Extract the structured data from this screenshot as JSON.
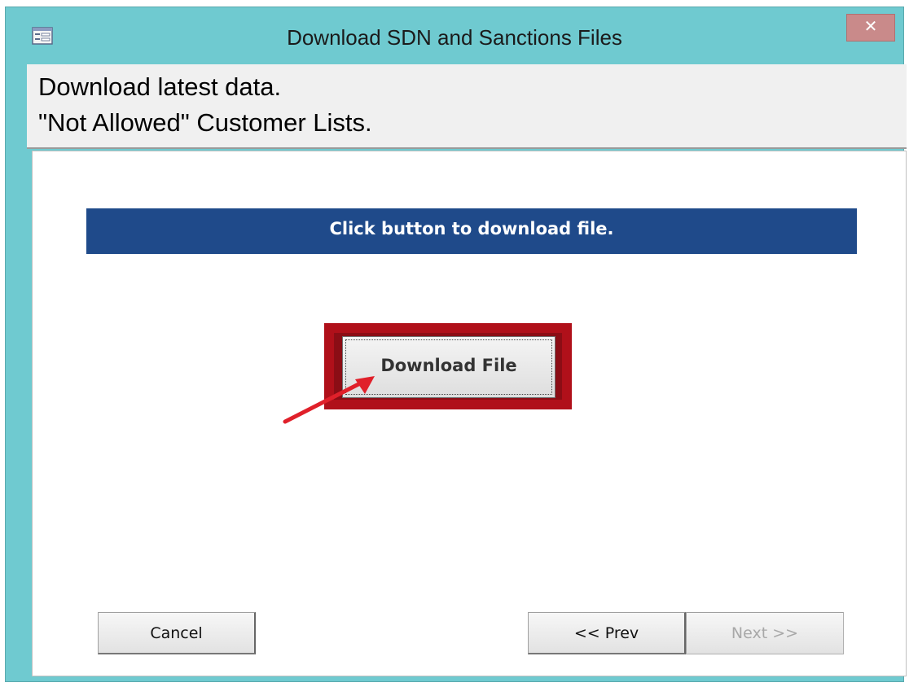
{
  "window": {
    "title": "Download SDN and Sanctions  Files",
    "close_label": "✕"
  },
  "header": {
    "line1": "Download latest data.",
    "line2": "\"Not Allowed\" Customer Lists."
  },
  "banner": {
    "text": "Click button to  download file."
  },
  "main": {
    "download_label": "Download File"
  },
  "footer": {
    "cancel_label": "Cancel",
    "prev_label": "<< Prev",
    "next_label": "Next >>",
    "next_enabled": false
  },
  "colors": {
    "window_frame": "#6fcad0",
    "banner": "#1f4a8a",
    "highlight": "#b0101a",
    "arrow": "#e0202a"
  },
  "icons": {
    "app": "form-icon",
    "close": "close-icon",
    "annotation": "arrow-icon"
  }
}
